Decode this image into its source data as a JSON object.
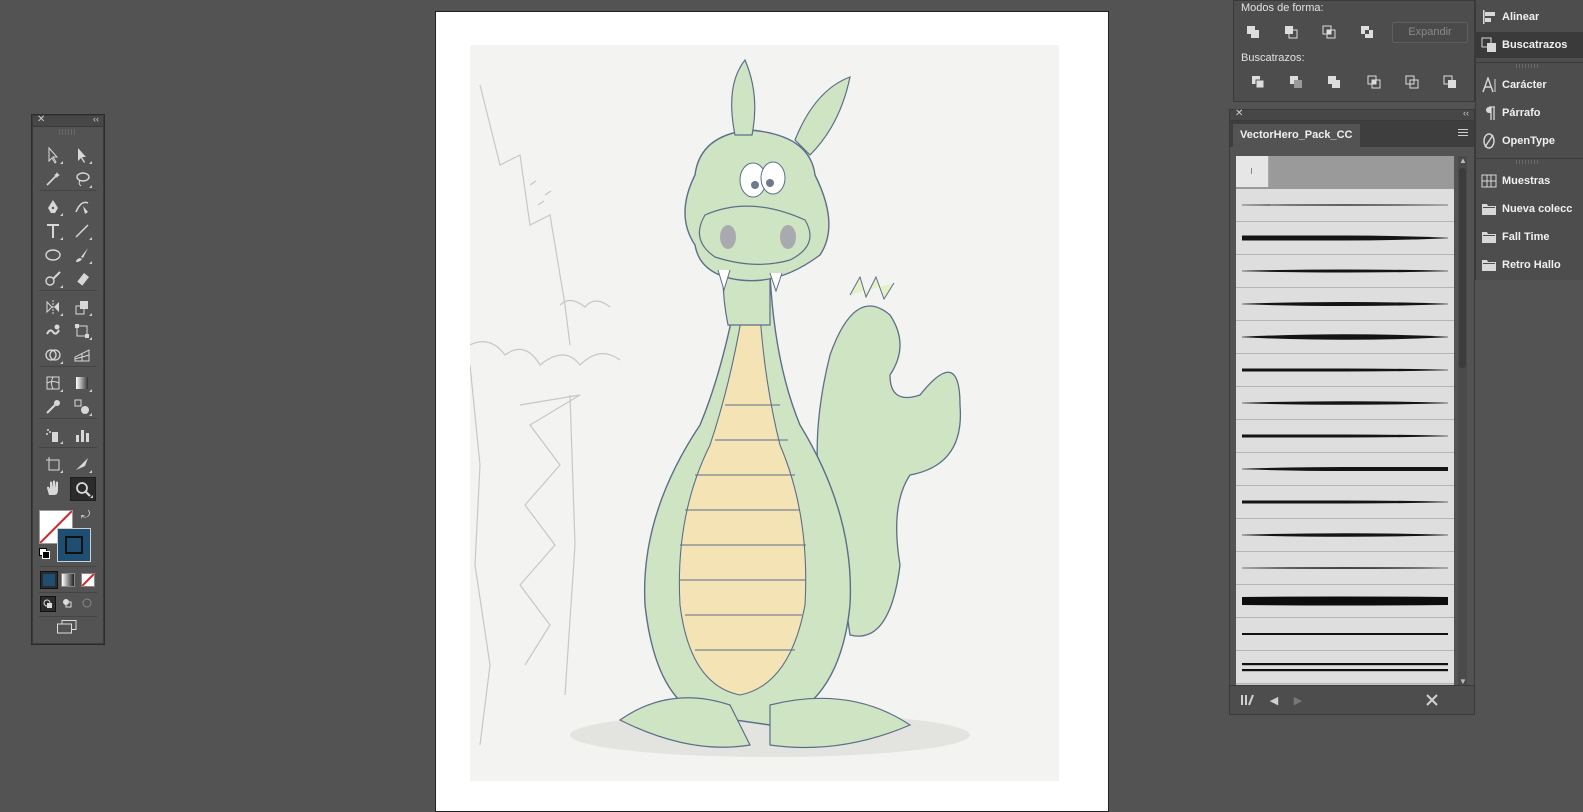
{
  "tools_panel": {
    "close_glyph": "✕",
    "collapse_glyph": "‹‹",
    "tools": [
      {
        "name": "selection-tool-icon"
      },
      {
        "name": "direct-selection-tool-icon"
      },
      {
        "name": "magic-wand-tool-icon"
      },
      {
        "name": "lasso-tool-icon"
      },
      {
        "name": "pen-tool-icon"
      },
      {
        "name": "curvature-tool-icon"
      },
      {
        "name": "type-tool-icon"
      },
      {
        "name": "line-segment-tool-icon"
      },
      {
        "name": "ellipse-tool-icon"
      },
      {
        "name": "paintbrush-tool-icon"
      },
      {
        "name": "shaper-tool-icon"
      },
      {
        "name": "eraser-tool-icon"
      },
      {
        "name": "reflect-tool-icon"
      },
      {
        "name": "scale-tool-icon"
      },
      {
        "name": "warp-tool-icon"
      },
      {
        "name": "free-transform-tool-icon"
      },
      {
        "name": "shape-builder-tool-icon"
      },
      {
        "name": "perspective-grid-tool-icon"
      },
      {
        "name": "mesh-tool-icon"
      },
      {
        "name": "gradient-tool-icon"
      },
      {
        "name": "eyedropper-tool-icon"
      },
      {
        "name": "blend-tool-icon"
      },
      {
        "name": "symbol-sprayer-tool-icon"
      },
      {
        "name": "column-graph-tool-icon"
      },
      {
        "name": "artboard-tool-icon"
      },
      {
        "name": "slice-tool-icon"
      },
      {
        "name": "hand-tool-icon"
      },
      {
        "name": "zoom-tool-icon",
        "active": true
      }
    ],
    "fill_color": "#ffffff",
    "stroke_color": "#1e4f73"
  },
  "pathfinder": {
    "shape_modes_label": "Modos de forma:",
    "pathfinders_label": "Buscatrazos:",
    "expand_label": "Expandir"
  },
  "brushes": {
    "tab_label": "VectorHero_Pack_CC",
    "strokes": [
      {
        "w": 1.2,
        "taper": "both"
      },
      {
        "w": 5,
        "taper": "end"
      },
      {
        "w": 3,
        "taper": "both"
      },
      {
        "w": 4,
        "taper": "both"
      },
      {
        "w": 5.5,
        "taper": "both"
      },
      {
        "w": 3,
        "taper": "end"
      },
      {
        "w": 3.5,
        "taper": "both"
      },
      {
        "w": 3,
        "taper": "end"
      },
      {
        "w": 4,
        "taper": "start"
      },
      {
        "w": 3,
        "taper": "end"
      },
      {
        "w": 3.5,
        "taper": "both"
      },
      {
        "w": 1.5,
        "taper": "both"
      },
      {
        "w": 8,
        "taper": "rough"
      },
      {
        "w": 2,
        "taper": "flat"
      },
      {
        "w": 2,
        "taper": "double"
      }
    ]
  },
  "dock": {
    "items": [
      {
        "name": "dock-alinear",
        "icon": "align-icon",
        "label": "Alinear",
        "active": false
      },
      {
        "name": "dock-buscatrazos",
        "icon": "pathfinder-icon",
        "label": "Buscatrazos",
        "active": true
      },
      {
        "name": "dock-caracter",
        "icon": "character-icon",
        "label": "Carácter",
        "active": false
      },
      {
        "name": "dock-parrafo",
        "icon": "paragraph-icon",
        "label": "Párrafo",
        "active": false
      },
      {
        "name": "dock-opentype",
        "icon": "opentype-icon",
        "label": "OpenType",
        "active": false
      },
      {
        "name": "dock-muestras",
        "icon": "swatches-icon",
        "label": "Muestras",
        "active": false
      },
      {
        "name": "dock-nueva-coleccion",
        "icon": "folder-icon",
        "label": "Nueva colecc",
        "active": false
      },
      {
        "name": "dock-fall-time",
        "icon": "folder-icon",
        "label": "Fall Time",
        "active": false
      },
      {
        "name": "dock-retro-halloween",
        "icon": "folder-icon",
        "label": "Retro Hallo",
        "active": false
      }
    ]
  }
}
